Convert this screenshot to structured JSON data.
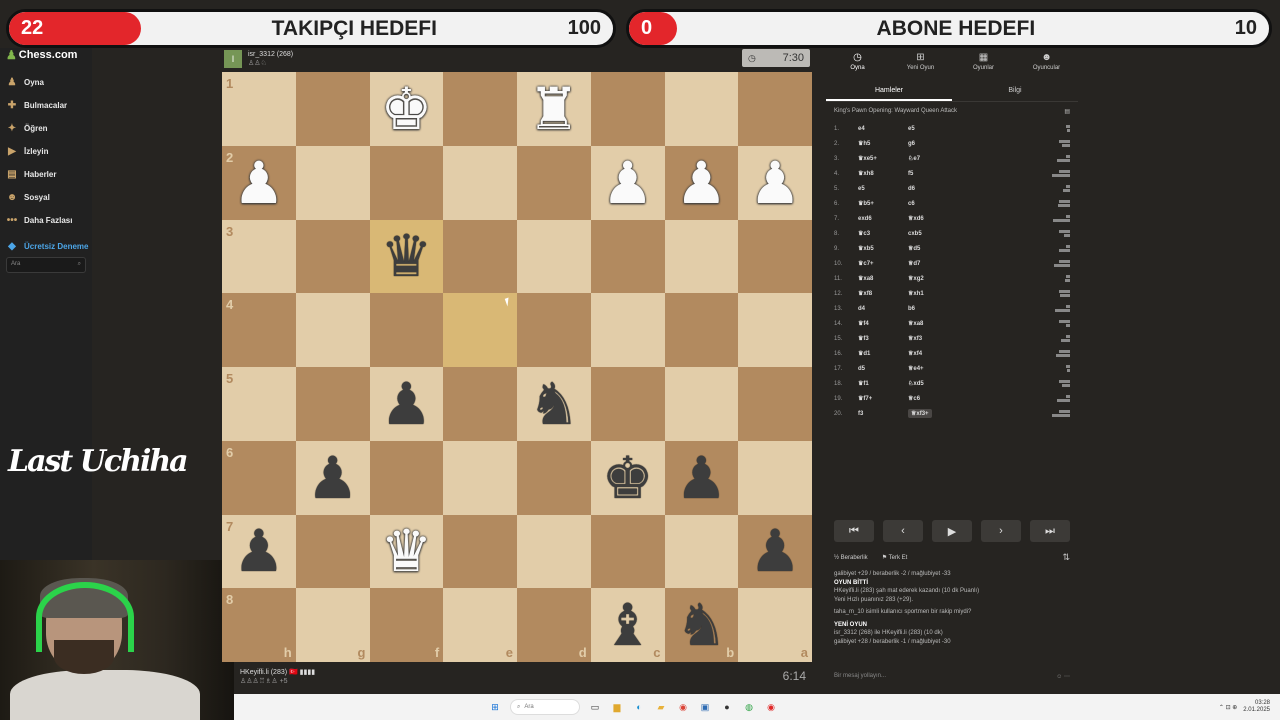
{
  "overlay": {
    "followers": {
      "count": "22",
      "title": "TAKIPÇI HEDEFI",
      "goal": "100"
    },
    "subscribers": {
      "count": "0",
      "title": "ABONE HEDEFI",
      "goal": "10"
    }
  },
  "browser": {
    "url_fragment": "e/147471037914"
  },
  "sidebar": {
    "logo": "Chess.com",
    "items": [
      {
        "label": "Oyna",
        "icon": "play-icon"
      },
      {
        "label": "Bulmacalar",
        "icon": "puzzle-icon"
      },
      {
        "label": "Öğren",
        "icon": "learn-icon"
      },
      {
        "label": "İzleyin",
        "icon": "watch-icon"
      },
      {
        "label": "Haberler",
        "icon": "news-icon"
      },
      {
        "label": "Sosyal",
        "icon": "social-icon"
      },
      {
        "label": "Daha Fazlası",
        "icon": "more-icon"
      },
      {
        "label": "Ücretsiz Deneme",
        "icon": "diamond-icon"
      }
    ],
    "search_placeholder": "Ara"
  },
  "stream": {
    "signature": "Last Uchiha"
  },
  "top_player": {
    "name": "isr_3312 (268)",
    "captured": "♙♙♘",
    "avatar": "I",
    "clock": "7:30"
  },
  "bottom_player": {
    "name": "HKeyifli.li (283) 🇹🇷 ▮▮▮▮",
    "captured": "♙♙♙♖♗♙ +5",
    "clock": "6:14"
  },
  "board": {
    "ranks": [
      "1",
      "2",
      "3",
      "4",
      "5",
      "6",
      "7",
      "8"
    ],
    "files": [
      "h",
      "g",
      "f",
      "e",
      "d",
      "c",
      "b",
      "a"
    ],
    "rows": [
      [
        [
          "",
          ""
        ],
        [
          "",
          ""
        ],
        [
          "K",
          "w"
        ],
        [
          "",
          ""
        ],
        [
          "R",
          "w"
        ],
        [
          "",
          ""
        ],
        [
          "",
          ""
        ],
        [
          "",
          ""
        ]
      ],
      [
        [
          "P",
          "w"
        ],
        [
          "",
          ""
        ],
        [
          "",
          ""
        ],
        [
          "",
          ""
        ],
        [
          "",
          ""
        ],
        [
          "P",
          "w"
        ],
        [
          "P",
          "w"
        ],
        [
          "P",
          "w"
        ]
      ],
      [
        [
          "",
          ""
        ],
        [
          "",
          ""
        ],
        [
          "Q",
          "b"
        ],
        [
          "",
          ""
        ],
        [
          "",
          ""
        ],
        [
          "",
          ""
        ],
        [
          "",
          ""
        ],
        [
          "",
          ""
        ]
      ],
      [
        [
          "",
          ""
        ],
        [
          "",
          ""
        ],
        [
          "",
          ""
        ],
        [
          "",
          ""
        ],
        [
          "",
          ""
        ],
        [
          "",
          ""
        ],
        [
          "",
          ""
        ],
        [
          "",
          ""
        ]
      ],
      [
        [
          "",
          ""
        ],
        [
          "",
          ""
        ],
        [
          "P",
          "b"
        ],
        [
          "",
          ""
        ],
        [
          "N",
          "b"
        ],
        [
          "",
          ""
        ],
        [
          "",
          ""
        ],
        [
          "",
          ""
        ]
      ],
      [
        [
          "",
          ""
        ],
        [
          "P",
          "b"
        ],
        [
          "",
          ""
        ],
        [
          "",
          ""
        ],
        [
          "",
          ""
        ],
        [
          "K",
          "b"
        ],
        [
          "P",
          "b"
        ],
        [
          "",
          ""
        ]
      ],
      [
        [
          "P",
          "b"
        ],
        [
          "",
          ""
        ],
        [
          "Q",
          "w"
        ],
        [
          "",
          ""
        ],
        [
          "",
          ""
        ],
        [
          "",
          ""
        ],
        [
          "",
          ""
        ],
        [
          "P",
          "b"
        ]
      ],
      [
        [
          "",
          ""
        ],
        [
          "",
          ""
        ],
        [
          "",
          ""
        ],
        [
          "",
          ""
        ],
        [
          "",
          ""
        ],
        [
          "B",
          "b"
        ],
        [
          "N",
          "b"
        ],
        [
          "",
          ""
        ]
      ]
    ],
    "highlights": [
      [
        2,
        2
      ],
      [
        3,
        3
      ]
    ]
  },
  "panel": {
    "tabs": [
      {
        "label": "Oyna",
        "icon": "clock-icon"
      },
      {
        "label": "Yeni Oyun",
        "icon": "plus-icon"
      },
      {
        "label": "Oyunlar",
        "icon": "grid-icon"
      },
      {
        "label": "Oyuncular",
        "icon": "players-icon"
      }
    ],
    "subtabs": [
      "Hamleler",
      "Bilgi"
    ],
    "opening": "King's Pawn Opening: Wayward Queen Attack",
    "moves": [
      {
        "n": "1.",
        "w": "e4",
        "b": "e5"
      },
      {
        "n": "2.",
        "w": "♛h5",
        "b": "g6"
      },
      {
        "n": "3.",
        "w": "♛xe5+",
        "b": "♘e7"
      },
      {
        "n": "4.",
        "w": "♛xh8",
        "b": "f5"
      },
      {
        "n": "5.",
        "w": "e5",
        "b": "d6"
      },
      {
        "n": "6.",
        "w": "♛b5+",
        "b": "c6"
      },
      {
        "n": "7.",
        "w": "exd6",
        "b": "♕xd6"
      },
      {
        "n": "8.",
        "w": "♛c3",
        "b": "cxb5"
      },
      {
        "n": "9.",
        "w": "♛xb5",
        "b": "♕d5"
      },
      {
        "n": "10.",
        "w": "♛c7+",
        "b": "♕d7"
      },
      {
        "n": "11.",
        "w": "♛xa8",
        "b": "♕xg2"
      },
      {
        "n": "12.",
        "w": "♛xf8",
        "b": "♕xh1"
      },
      {
        "n": "13.",
        "w": "d4",
        "b": "b6"
      },
      {
        "n": "14.",
        "w": "♛f4",
        "b": "♕xa8"
      },
      {
        "n": "15.",
        "w": "♛f3",
        "b": "♕xf3"
      },
      {
        "n": "16.",
        "w": "♛d1",
        "b": "♕xf4"
      },
      {
        "n": "17.",
        "w": "d5",
        "b": "♕e4+"
      },
      {
        "n": "18.",
        "w": "♛f1",
        "b": "♘xd5"
      },
      {
        "n": "19.",
        "w": "♛f7+",
        "b": "♕c6"
      },
      {
        "n": "20.",
        "w": "f3",
        "b": "♕xf3+"
      }
    ],
    "nav": [
      "⏮",
      "‹",
      "▶",
      "›",
      "⏭"
    ],
    "actions": {
      "draw": "Beraberlik",
      "resign": "Terk Et"
    },
    "chat": [
      {
        "text": "galibiyet +29 / beraberlik -2 / mağlubiyet -33",
        "bold": false
      },
      {
        "text": "OYUN BİTTİ",
        "bold": true
      },
      {
        "text": "HKeyifli.li (283) şah mat ederek kazandı (10 dk Puanlı)",
        "bold": false
      },
      {
        "text": "Yeni Hızlı puanınız 283 (+29).",
        "bold": false
      },
      {
        "text": "taha_m_10 isimli kullanıcı sportmen bir rakip miydi?",
        "bold": false
      },
      {
        "text": "YENİ OYUN",
        "bold": true
      },
      {
        "text": "isr_3312 (268) ile HKeyifli.li (283) (10 dk)",
        "bold": false
      },
      {
        "text": "galibiyet +28 / beraberlik -1 / mağlubiyet -30",
        "bold": false
      }
    ],
    "chat_placeholder": "Bir mesaj yollayın..."
  },
  "taskbar": {
    "search": "Ara",
    "time": "03:28",
    "date": "2.01.2025"
  }
}
